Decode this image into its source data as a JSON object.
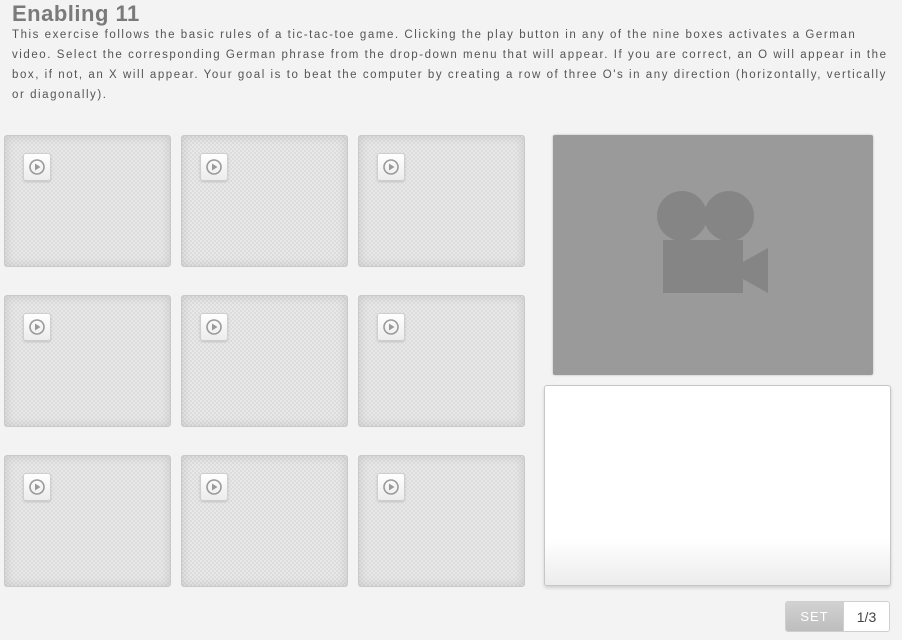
{
  "header": {
    "title": "Enabling 11",
    "instructions": "This exercise follows the basic rules of a tic-tac-toe game. Clicking the play button in any of the nine boxes activates a German video. Select the corresponding German phrase from the drop-down menu that will appear. If you are correct, an O will appear in the box, if not, an X will appear. Your goal is to beat the computer by creating a row of three O's in any direction (horizontally, vertically or diagonally)."
  },
  "board": {
    "cells": [
      {
        "icon": "play-icon"
      },
      {
        "icon": "play-icon"
      },
      {
        "icon": "play-icon"
      },
      {
        "icon": "play-icon"
      },
      {
        "icon": "play-icon"
      },
      {
        "icon": "play-icon"
      },
      {
        "icon": "play-icon"
      },
      {
        "icon": "play-icon"
      },
      {
        "icon": "play-icon"
      }
    ]
  },
  "video": {
    "placeholder_icon": "video-camera-icon"
  },
  "set_counter": {
    "label": "SET",
    "value": "1/3"
  },
  "colors": {
    "page_background": "#f3f3f3",
    "title": "#7a7a7a",
    "cell_background": "#dcdcdc",
    "video_panel": "#9a9a9a",
    "camera_icon": "#858585"
  }
}
